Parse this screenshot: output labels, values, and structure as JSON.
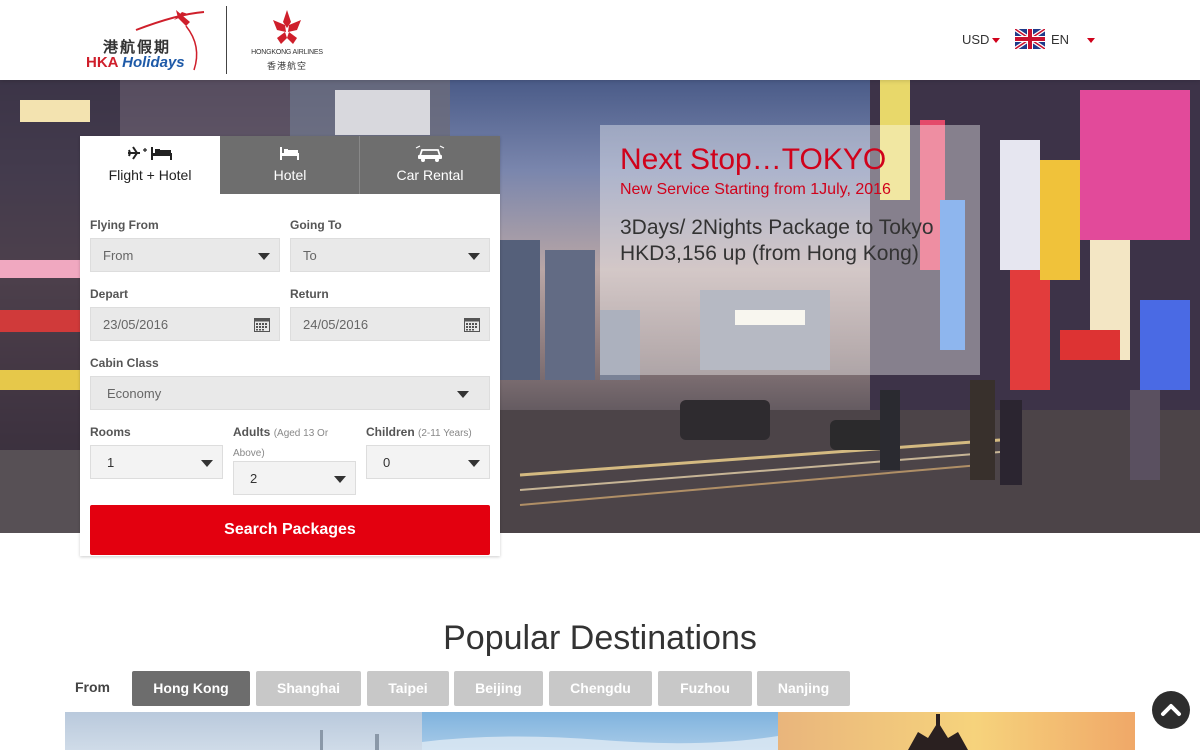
{
  "header": {
    "logo_hka_cn": "港航假期",
    "logo_hka_en_1": "HKA",
    "logo_hka_en_2": "Holidays",
    "logo_hx_en": "HONGKONG AIRLINES",
    "logo_hx_cn": "香港航空",
    "currency": "USD",
    "language": "EN"
  },
  "promo": {
    "title": "Next Stop…TOKYO",
    "subtitle": "New Service Starting from 1July, 2016",
    "body": "3Days/ 2Nights Package to Tokyo HKD3,156 up (from Hong Kong)"
  },
  "booking": {
    "tabs": [
      {
        "label": "Flight + Hotel",
        "icon": "plane-bed-icon"
      },
      {
        "label": "Hotel",
        "icon": "bed-icon"
      },
      {
        "label": "Car Rental",
        "icon": "car-icon"
      }
    ],
    "flying_from_label": "Flying From",
    "flying_from_placeholder": "From",
    "going_to_label": "Going To",
    "going_to_placeholder": "To",
    "depart_label": "Depart",
    "depart_value": "23/05/2016",
    "return_label": "Return",
    "return_value": "24/05/2016",
    "cabin_label": "Cabin Class",
    "cabin_value": "Economy",
    "rooms_label": "Rooms",
    "rooms_value": "1",
    "adults_label": "Adults",
    "adults_note": "(Aged 13 Or Above)",
    "adults_value": "2",
    "children_label": "Children",
    "children_note": "(2-11 Years)",
    "children_value": "0",
    "search_label": "Search Packages"
  },
  "destinations": {
    "title": "Popular Destinations",
    "from_label": "From",
    "cities": [
      "Hong Kong",
      "Shanghai",
      "Taipei",
      "Beijing",
      "Chengdu",
      "Fuzhou",
      "Nanjing"
    ]
  },
  "colors": {
    "brand_red": "#e3000f",
    "active_tab": "#6d6d6d",
    "inactive_tab": "#c8c8c8"
  }
}
